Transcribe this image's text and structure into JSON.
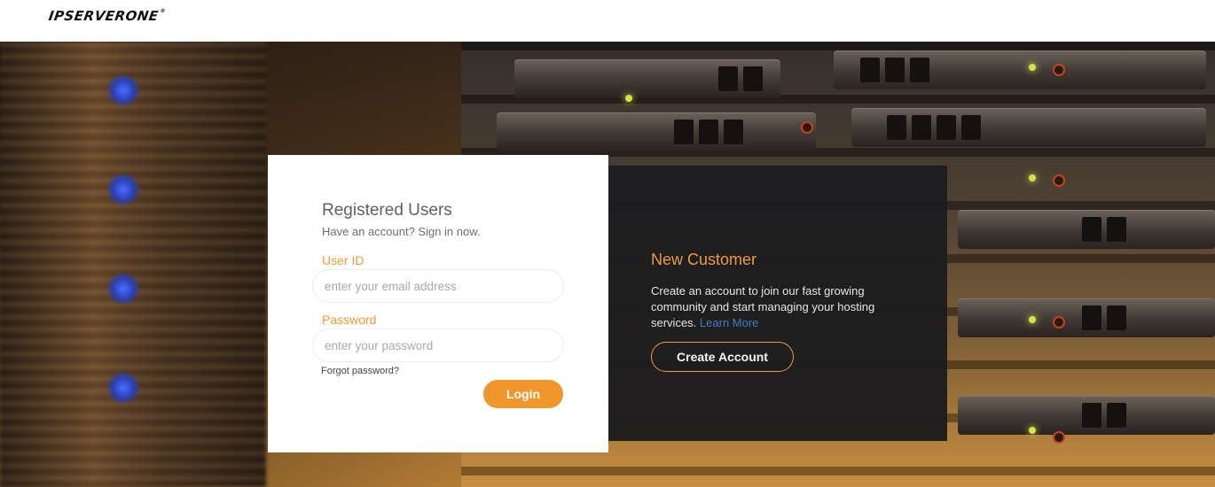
{
  "header": {
    "logo_text": "IPSERVERONE",
    "logo_mark": "®"
  },
  "login": {
    "title": "Registered Users",
    "subtitle": "Have an account? Sign in now.",
    "userid_label": "User ID",
    "userid_placeholder": "enter your email address",
    "password_label": "Password",
    "password_placeholder": "enter your password",
    "forgot_label": "Forgot password?",
    "login_button": "Login"
  },
  "new_customer": {
    "title": "New Customer",
    "description": "Create an account to join our fast growing community and start managing your hosting services.",
    "learn_more": "Learn More",
    "create_button": "Create Account"
  },
  "colors": {
    "accent": "#f0962a",
    "link": "#3b7fc2",
    "panel_dark": "#1c1c1e"
  }
}
